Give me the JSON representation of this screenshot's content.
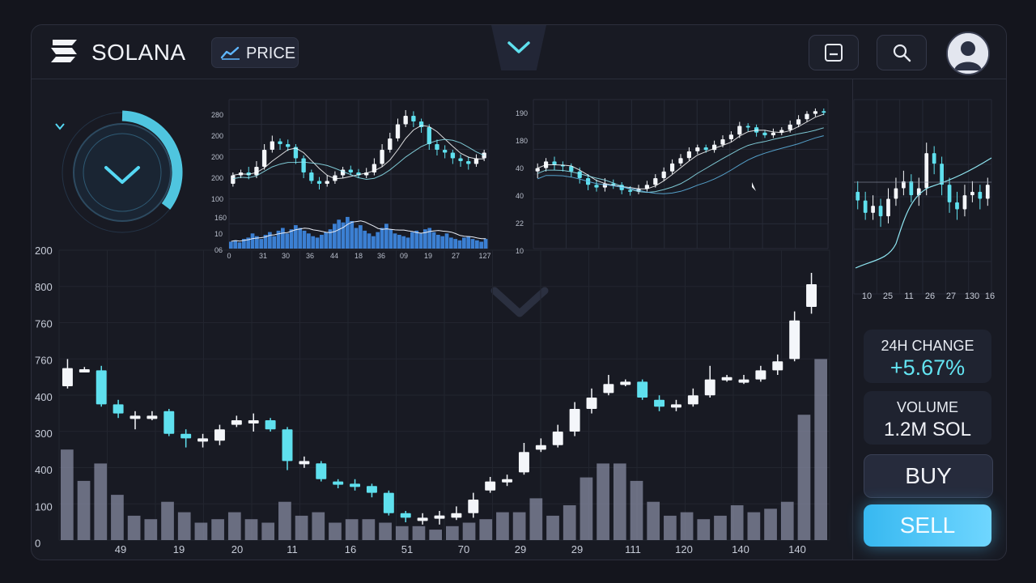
{
  "header": {
    "brand": "SOLANA",
    "price_tab": "PRICE"
  },
  "stats": {
    "change_label": "24H CHANGE",
    "change_value": "+5.67%",
    "volume_label": "VOLUME",
    "volume_value": "1.2M SOL"
  },
  "actions": {
    "buy": "BUY",
    "sell": "SELL"
  },
  "colors": {
    "accent": "#5fe0ee",
    "bull": "#f4f6fa",
    "bear": "#5fe0ee",
    "volume": "#8a8fa6",
    "mini_volume": "#3f8be6"
  },
  "chart_data": [
    {
      "type": "candlestick",
      "title": "",
      "y_tick_labels": [
        "200",
        "800",
        "760",
        "760",
        "400",
        "300",
        "400",
        "100",
        "0"
      ],
      "x_tick_labels": [
        "49",
        "19",
        "20",
        "11",
        "16",
        "51",
        "70",
        "29",
        "29",
        "111",
        "120",
        "140",
        "140"
      ],
      "candles": [
        {
          "o": 550,
          "c": 630,
          "h": 670,
          "l": 540
        },
        {
          "o": 625,
          "c": 625,
          "h": 635,
          "l": 615
        },
        {
          "o": 620,
          "c": 470,
          "h": 640,
          "l": 460
        },
        {
          "o": 470,
          "c": 430,
          "h": 490,
          "l": 410
        },
        {
          "o": 420,
          "c": 420,
          "h": 440,
          "l": 360
        },
        {
          "o": 420,
          "c": 420,
          "h": 440,
          "l": 400
        },
        {
          "o": 440,
          "c": 340,
          "h": 450,
          "l": 330
        },
        {
          "o": 340,
          "c": 320,
          "h": 360,
          "l": 280
        },
        {
          "o": 320,
          "c": 320,
          "h": 340,
          "l": 280
        },
        {
          "o": 310,
          "c": 360,
          "h": 380,
          "l": 290
        },
        {
          "o": 380,
          "c": 400,
          "h": 420,
          "l": 370
        },
        {
          "o": 400,
          "c": 400,
          "h": 430,
          "l": 350
        },
        {
          "o": 400,
          "c": 360,
          "h": 410,
          "l": 350
        },
        {
          "o": 360,
          "c": 220,
          "h": 370,
          "l": 180
        },
        {
          "o": 220,
          "c": 220,
          "h": 240,
          "l": 190
        },
        {
          "o": 210,
          "c": 140,
          "h": 220,
          "l": 130
        },
        {
          "o": 130,
          "c": 120,
          "h": 140,
          "l": 100
        },
        {
          "o": 120,
          "c": 110,
          "h": 140,
          "l": 90
        },
        {
          "o": 110,
          "c": 80,
          "h": 120,
          "l": 60
        },
        {
          "o": 80,
          "c": -10,
          "h": 90,
          "l": -20
        },
        {
          "o": -10,
          "c": -30,
          "h": 0,
          "l": -50
        },
        {
          "o": -30,
          "c": -30,
          "h": -10,
          "l": -60
        },
        {
          "o": -30,
          "c": -20,
          "h": 0,
          "l": -60
        },
        {
          "o": -30,
          "c": -10,
          "h": 20,
          "l": -40
        },
        {
          "o": -10,
          "c": 50,
          "h": 80,
          "l": -30
        },
        {
          "o": 90,
          "c": 130,
          "h": 150,
          "l": 80
        },
        {
          "o": 130,
          "c": 140,
          "h": 160,
          "l": 110
        },
        {
          "o": 170,
          "c": 260,
          "h": 300,
          "l": 160
        },
        {
          "o": 270,
          "c": 290,
          "h": 320,
          "l": 260
        },
        {
          "o": 290,
          "c": 350,
          "h": 380,
          "l": 280
        },
        {
          "o": 350,
          "c": 450,
          "h": 480,
          "l": 330
        },
        {
          "o": 450,
          "c": 500,
          "h": 540,
          "l": 430
        },
        {
          "o": 520,
          "c": 560,
          "h": 600,
          "l": 510
        },
        {
          "o": 560,
          "c": 570,
          "h": 580,
          "l": 550
        },
        {
          "o": 570,
          "c": 500,
          "h": 580,
          "l": 490
        },
        {
          "o": 490,
          "c": 460,
          "h": 510,
          "l": 440
        },
        {
          "o": 470,
          "c": 470,
          "h": 490,
          "l": 440
        },
        {
          "o": 470,
          "c": 510,
          "h": 540,
          "l": 460
        },
        {
          "o": 510,
          "c": 580,
          "h": 640,
          "l": 500
        },
        {
          "o": 590,
          "c": 590,
          "h": 600,
          "l": 570
        },
        {
          "o": 580,
          "c": 580,
          "h": 600,
          "l": 560
        },
        {
          "o": 580,
          "c": 620,
          "h": 640,
          "l": 570
        },
        {
          "o": 620,
          "c": 660,
          "h": 690,
          "l": 600
        },
        {
          "o": 670,
          "c": 840,
          "h": 880,
          "l": 660
        },
        {
          "o": 900,
          "c": 1000,
          "h": 1050,
          "l": 870
        }
      ],
      "volumes": [
        26,
        17,
        22,
        13,
        7,
        6,
        11,
        8,
        5,
        6,
        8,
        6,
        5,
        11,
        7,
        8,
        5,
        6,
        6,
        5,
        4,
        4,
        3,
        4,
        5,
        6,
        8,
        8,
        12,
        7,
        10,
        18,
        22,
        22,
        17,
        11,
        7,
        8,
        6,
        7,
        10,
        8,
        9,
        11,
        36,
        52
      ]
    },
    {
      "type": "candlestick",
      "title": "",
      "y_tick_labels": [
        "280",
        "200",
        "200",
        "200",
        "100"
      ],
      "x_tick_labels": [
        "0",
        "31",
        "30",
        "36",
        "44",
        "18",
        "36",
        "09",
        "19",
        "27",
        "127"
      ],
      "volume_tick_labels": [
        "160",
        "10",
        "06"
      ],
      "candles": [
        {
          "o": 40,
          "c": 55,
          "h": 60,
          "l": 35
        },
        {
          "o": 55,
          "c": 60,
          "h": 65,
          "l": 50
        },
        {
          "o": 60,
          "c": 55,
          "h": 70,
          "l": 48
        },
        {
          "o": 55,
          "c": 70,
          "h": 80,
          "l": 50
        },
        {
          "o": 70,
          "c": 100,
          "h": 110,
          "l": 65
        },
        {
          "o": 100,
          "c": 115,
          "h": 125,
          "l": 95
        },
        {
          "o": 115,
          "c": 110,
          "h": 120,
          "l": 100
        },
        {
          "o": 110,
          "c": 105,
          "h": 118,
          "l": 98
        },
        {
          "o": 105,
          "c": 85,
          "h": 110,
          "l": 75
        },
        {
          "o": 85,
          "c": 60,
          "h": 90,
          "l": 50
        },
        {
          "o": 60,
          "c": 45,
          "h": 65,
          "l": 40
        },
        {
          "o": 45,
          "c": 40,
          "h": 52,
          "l": 30
        },
        {
          "o": 40,
          "c": 45,
          "h": 55,
          "l": 35
        },
        {
          "o": 45,
          "c": 55,
          "h": 62,
          "l": 40
        },
        {
          "o": 55,
          "c": 65,
          "h": 70,
          "l": 50
        },
        {
          "o": 65,
          "c": 60,
          "h": 72,
          "l": 55
        },
        {
          "o": 60,
          "c": 55,
          "h": 66,
          "l": 50
        },
        {
          "o": 55,
          "c": 60,
          "h": 68,
          "l": 50
        },
        {
          "o": 60,
          "c": 75,
          "h": 85,
          "l": 55
        },
        {
          "o": 75,
          "c": 100,
          "h": 110,
          "l": 70
        },
        {
          "o": 100,
          "c": 120,
          "h": 130,
          "l": 95
        },
        {
          "o": 120,
          "c": 145,
          "h": 155,
          "l": 115
        },
        {
          "o": 145,
          "c": 160,
          "h": 170,
          "l": 140
        },
        {
          "o": 160,
          "c": 150,
          "h": 168,
          "l": 140
        },
        {
          "o": 150,
          "c": 140,
          "h": 155,
          "l": 130
        },
        {
          "o": 140,
          "c": 110,
          "h": 145,
          "l": 100
        },
        {
          "o": 110,
          "c": 100,
          "h": 118,
          "l": 90
        },
        {
          "o": 100,
          "c": 95,
          "h": 108,
          "l": 85
        },
        {
          "o": 95,
          "c": 85,
          "h": 100,
          "l": 75
        },
        {
          "o": 85,
          "c": 80,
          "h": 92,
          "l": 70
        },
        {
          "o": 80,
          "c": 75,
          "h": 88,
          "l": 65
        },
        {
          "o": 75,
          "c": 85,
          "h": 92,
          "l": 70
        },
        {
          "o": 85,
          "c": 95,
          "h": 100,
          "l": 80
        }
      ],
      "volumes": [
        10,
        12,
        9,
        14,
        16,
        22,
        18,
        14,
        20,
        24,
        18,
        26,
        30,
        22,
        28,
        34,
        30,
        26,
        22,
        18,
        16,
        20,
        24,
        28,
        36,
        42,
        38,
        46,
        40,
        30,
        34,
        26,
        22,
        18,
        24,
        30,
        36,
        28,
        22,
        20,
        18,
        16,
        24,
        26,
        22,
        28,
        30,
        24,
        20,
        18,
        22,
        16,
        14,
        12,
        16,
        18,
        14,
        12,
        10,
        14
      ]
    },
    {
      "type": "candlestick",
      "title": "",
      "y_tick_labels": [
        "190",
        "180",
        "40",
        "40",
        "22",
        "10"
      ],
      "candles": [
        {
          "o": 60,
          "c": 65,
          "h": 72,
          "l": 50
        },
        {
          "o": 65,
          "c": 75,
          "h": 80,
          "l": 60
        },
        {
          "o": 75,
          "c": 70,
          "h": 82,
          "l": 62
        },
        {
          "o": 70,
          "c": 68,
          "h": 75,
          "l": 60
        },
        {
          "o": 68,
          "c": 60,
          "h": 72,
          "l": 52
        },
        {
          "o": 60,
          "c": 50,
          "h": 66,
          "l": 42
        },
        {
          "o": 50,
          "c": 40,
          "h": 56,
          "l": 32
        },
        {
          "o": 40,
          "c": 36,
          "h": 48,
          "l": 30
        },
        {
          "o": 36,
          "c": 42,
          "h": 50,
          "l": 30
        },
        {
          "o": 42,
          "c": 40,
          "h": 48,
          "l": 34
        },
        {
          "o": 40,
          "c": 32,
          "h": 44,
          "l": 26
        },
        {
          "o": 32,
          "c": 30,
          "h": 38,
          "l": 24
        },
        {
          "o": 30,
          "c": 34,
          "h": 40,
          "l": 26
        },
        {
          "o": 34,
          "c": 40,
          "h": 46,
          "l": 30
        },
        {
          "o": 40,
          "c": 50,
          "h": 56,
          "l": 36
        },
        {
          "o": 50,
          "c": 60,
          "h": 66,
          "l": 46
        },
        {
          "o": 60,
          "c": 72,
          "h": 78,
          "l": 56
        },
        {
          "o": 72,
          "c": 80,
          "h": 86,
          "l": 68
        },
        {
          "o": 80,
          "c": 90,
          "h": 96,
          "l": 76
        },
        {
          "o": 90,
          "c": 96,
          "h": 100,
          "l": 86
        },
        {
          "o": 96,
          "c": 92,
          "h": 100,
          "l": 88
        },
        {
          "o": 92,
          "c": 100,
          "h": 106,
          "l": 88
        },
        {
          "o": 100,
          "c": 108,
          "h": 114,
          "l": 96
        },
        {
          "o": 108,
          "c": 115,
          "h": 120,
          "l": 104
        },
        {
          "o": 115,
          "c": 128,
          "h": 134,
          "l": 110
        },
        {
          "o": 128,
          "c": 126,
          "h": 132,
          "l": 120
        },
        {
          "o": 126,
          "c": 118,
          "h": 130,
          "l": 112
        },
        {
          "o": 118,
          "c": 114,
          "h": 122,
          "l": 110
        },
        {
          "o": 114,
          "c": 118,
          "h": 124,
          "l": 110
        },
        {
          "o": 118,
          "c": 122,
          "h": 126,
          "l": 114
        },
        {
          "o": 122,
          "c": 130,
          "h": 136,
          "l": 118
        },
        {
          "o": 130,
          "c": 138,
          "h": 144,
          "l": 126
        },
        {
          "o": 138,
          "c": 146,
          "h": 150,
          "l": 134
        },
        {
          "o": 146,
          "c": 150,
          "h": 154,
          "l": 142
        },
        {
          "o": 150,
          "c": 148,
          "h": 154,
          "l": 144
        }
      ]
    },
    {
      "type": "candlestick",
      "title": "",
      "x_tick_labels": [
        "10",
        "25",
        "11",
        "26",
        "27",
        "130",
        "16"
      ],
      "candles": [
        {
          "o": 60,
          "c": 55,
          "h": 66,
          "l": 50
        },
        {
          "o": 55,
          "c": 48,
          "h": 60,
          "l": 44
        },
        {
          "o": 48,
          "c": 52,
          "h": 58,
          "l": 44
        },
        {
          "o": 52,
          "c": 46,
          "h": 56,
          "l": 40
        },
        {
          "o": 46,
          "c": 56,
          "h": 62,
          "l": 42
        },
        {
          "o": 56,
          "c": 62,
          "h": 68,
          "l": 52
        },
        {
          "o": 62,
          "c": 66,
          "h": 72,
          "l": 58
        },
        {
          "o": 66,
          "c": 58,
          "h": 70,
          "l": 54
        },
        {
          "o": 58,
          "c": 62,
          "h": 68,
          "l": 52
        },
        {
          "o": 62,
          "c": 82,
          "h": 88,
          "l": 58
        },
        {
          "o": 82,
          "c": 76,
          "h": 86,
          "l": 70
        },
        {
          "o": 76,
          "c": 64,
          "h": 80,
          "l": 58
        },
        {
          "o": 64,
          "c": 54,
          "h": 68,
          "l": 48
        },
        {
          "o": 54,
          "c": 50,
          "h": 60,
          "l": 44
        },
        {
          "o": 50,
          "c": 58,
          "h": 64,
          "l": 46
        },
        {
          "o": 58,
          "c": 60,
          "h": 66,
          "l": 54
        },
        {
          "o": 60,
          "c": 56,
          "h": 64,
          "l": 50
        },
        {
          "o": 56,
          "c": 64,
          "h": 68,
          "l": 52
        }
      ]
    }
  ]
}
